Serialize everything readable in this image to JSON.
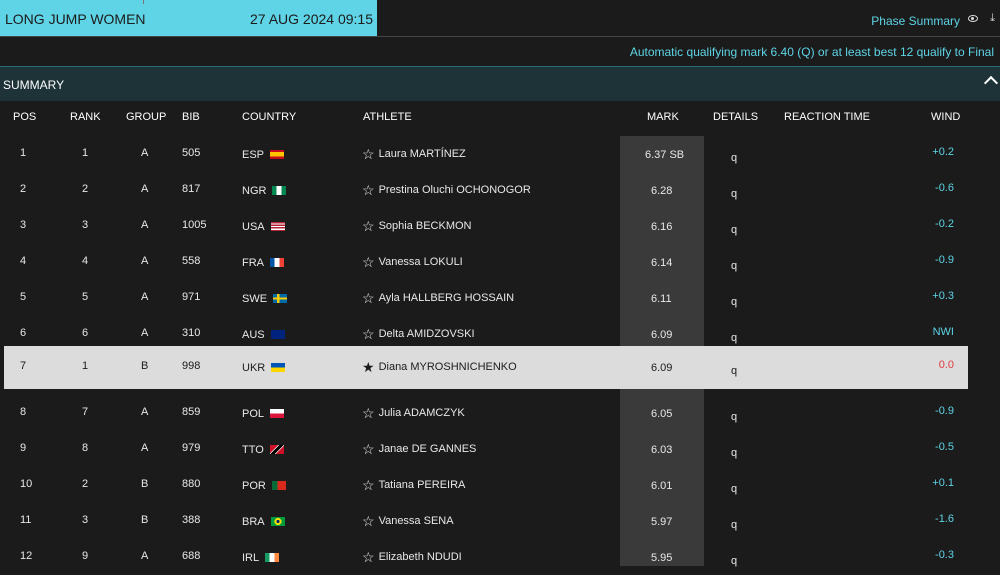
{
  "header": {
    "event": "LONG JUMP WOMEN",
    "datetime": "27 AUG 2024 09:15",
    "phase_link": "Phase Summary",
    "qualifying_note": "Automatic qualifying mark 6.40 (Q) or at least best 12 qualify to Final"
  },
  "summary": {
    "label": "SUMMARY"
  },
  "columns": {
    "pos": "POS",
    "rank": "RANK",
    "group": "GROUP",
    "bib": "BIB",
    "country": "COUNTRY",
    "athlete": "ATHLETE",
    "mark": "MARK",
    "details": "DETAILS",
    "reaction": "REACTION TIME",
    "wind": "WIND"
  },
  "rows": [
    {
      "pos": "1",
      "rank": "1",
      "group": "A",
      "bib": "505",
      "country": "ESP",
      "flag": "esp",
      "athlete": "Laura MARTÍNEZ",
      "mark": "6.37 SB",
      "details": "q",
      "wind": "+0.2",
      "wind_color": "#5ed4e6",
      "starred": false,
      "highlight": false
    },
    {
      "pos": "2",
      "rank": "2",
      "group": "A",
      "bib": "817",
      "country": "NGR",
      "flag": "ngr",
      "athlete": "Prestina Oluchi OCHONOGOR",
      "mark": "6.28",
      "details": "q",
      "wind": "-0.6",
      "wind_color": "#5ed4e6",
      "starred": false,
      "highlight": false
    },
    {
      "pos": "3",
      "rank": "3",
      "group": "A",
      "bib": "1005",
      "country": "USA",
      "flag": "usa",
      "athlete": "Sophia BECKMON",
      "mark": "6.16",
      "details": "q",
      "wind": "-0.2",
      "wind_color": "#5ed4e6",
      "starred": false,
      "highlight": false
    },
    {
      "pos": "4",
      "rank": "4",
      "group": "A",
      "bib": "558",
      "country": "FRA",
      "flag": "fra",
      "athlete": "Vanessa LOKULI",
      "mark": "6.14",
      "details": "q",
      "wind": "-0.9",
      "wind_color": "#5ed4e6",
      "starred": false,
      "highlight": false
    },
    {
      "pos": "5",
      "rank": "5",
      "group": "A",
      "bib": "971",
      "country": "SWE",
      "flag": "swe",
      "athlete": "Ayla HALLBERG HOSSAIN",
      "mark": "6.11",
      "details": "q",
      "wind": "+0.3",
      "wind_color": "#5ed4e6",
      "starred": false,
      "highlight": false
    },
    {
      "pos": "6",
      "rank": "6",
      "group": "A",
      "bib": "310",
      "country": "AUS",
      "flag": "aus",
      "athlete": "Delta AMIDZOVSKI",
      "mark": "6.09",
      "details": "q",
      "wind": "NWI",
      "wind_color": "#5ed4e6",
      "starred": false,
      "highlight": false
    },
    {
      "pos": "7",
      "rank": "1",
      "group": "B",
      "bib": "998",
      "country": "UKR",
      "flag": "ukr",
      "athlete": "Diana MYROSHNICHENKO",
      "mark": "6.09",
      "details": "q",
      "wind": "0.0",
      "wind_color": "#e0393e",
      "starred": true,
      "highlight": true
    },
    {
      "pos": "8",
      "rank": "7",
      "group": "A",
      "bib": "859",
      "country": "POL",
      "flag": "pol",
      "athlete": "Julia ADAMCZYK",
      "mark": "6.05",
      "details": "q",
      "wind": "-0.9",
      "wind_color": "#5ed4e6",
      "starred": false,
      "highlight": false
    },
    {
      "pos": "9",
      "rank": "8",
      "group": "A",
      "bib": "979",
      "country": "TTO",
      "flag": "tto",
      "athlete": "Janae DE GANNES",
      "mark": "6.03",
      "details": "q",
      "wind": "-0.5",
      "wind_color": "#5ed4e6",
      "starred": false,
      "highlight": false
    },
    {
      "pos": "10",
      "rank": "2",
      "group": "B",
      "bib": "880",
      "country": "POR",
      "flag": "por",
      "athlete": "Tatiana PEREIRA",
      "mark": "6.01",
      "details": "q",
      "wind": "+0.1",
      "wind_color": "#5ed4e6",
      "starred": false,
      "highlight": false
    },
    {
      "pos": "11",
      "rank": "3",
      "group": "B",
      "bib": "388",
      "country": "BRA",
      "flag": "bra",
      "athlete": "Vanessa SENA",
      "mark": "5.97",
      "details": "q",
      "wind": "-1.6",
      "wind_color": "#5ed4e6",
      "starred": false,
      "highlight": false
    },
    {
      "pos": "12",
      "rank": "9",
      "group": "A",
      "bib": "688",
      "country": "IRL",
      "flag": "irl",
      "athlete": "Elizabeth NDUDI",
      "mark": "5.95",
      "details": "q",
      "wind": "-0.3",
      "wind_color": "#5ed4e6",
      "starred": false,
      "highlight": false
    }
  ]
}
